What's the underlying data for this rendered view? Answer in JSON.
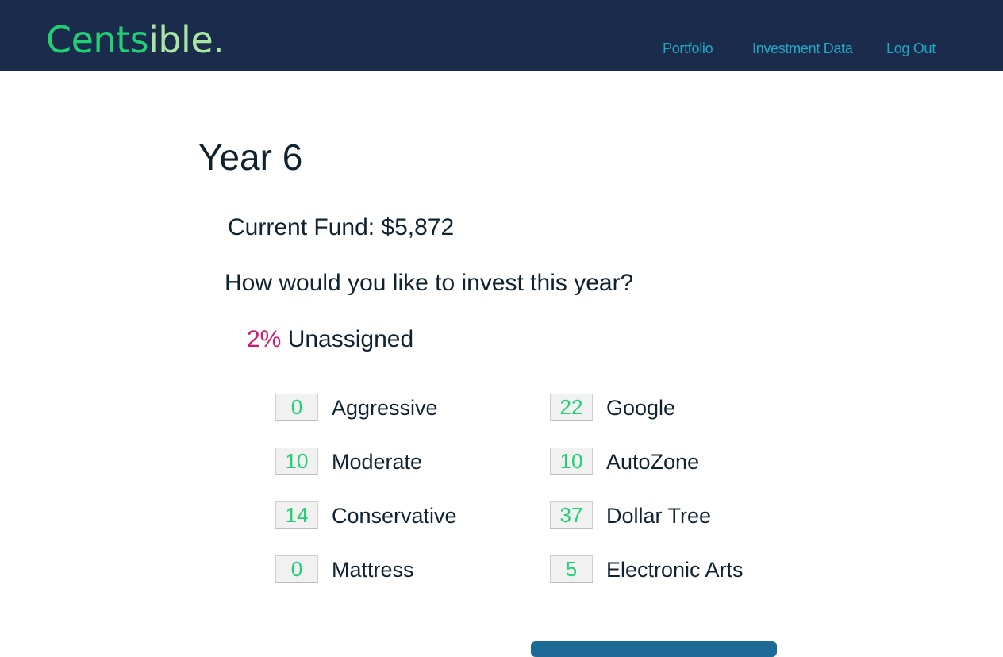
{
  "header": {
    "logo_part1": "Cents",
    "logo_part2": "ible.",
    "nav": {
      "portfolio": "Portfolio",
      "investment_data": "Investment Data",
      "log_out": "Log Out"
    }
  },
  "main": {
    "title": "Year 6",
    "current_fund": "Current Fund: $5,872",
    "question": "How would you like to invest this year?",
    "unassigned_pct": "2%",
    "unassigned_label": "Unassigned",
    "allocations_left": [
      {
        "value": "0",
        "label": "Aggressive"
      },
      {
        "value": "10",
        "label": "Moderate"
      },
      {
        "value": "14",
        "label": "Conservative"
      },
      {
        "value": "0",
        "label": "Mattress"
      }
    ],
    "allocations_right": [
      {
        "value": "22",
        "label": "Google"
      },
      {
        "value": "10",
        "label": "AutoZone"
      },
      {
        "value": "37",
        "label": "Dollar Tree"
      },
      {
        "value": "5",
        "label": "Electronic Arts"
      }
    ]
  },
  "colors": {
    "navbar_bg": "#1a2b4c",
    "logo_green": "#21cf74",
    "logo_light_green": "#a8e6a1",
    "nav_link": "#22a9c4",
    "unassigned_pct": "#d4166e",
    "input_value": "#21cf74",
    "submit_button": "#1e6a97"
  }
}
